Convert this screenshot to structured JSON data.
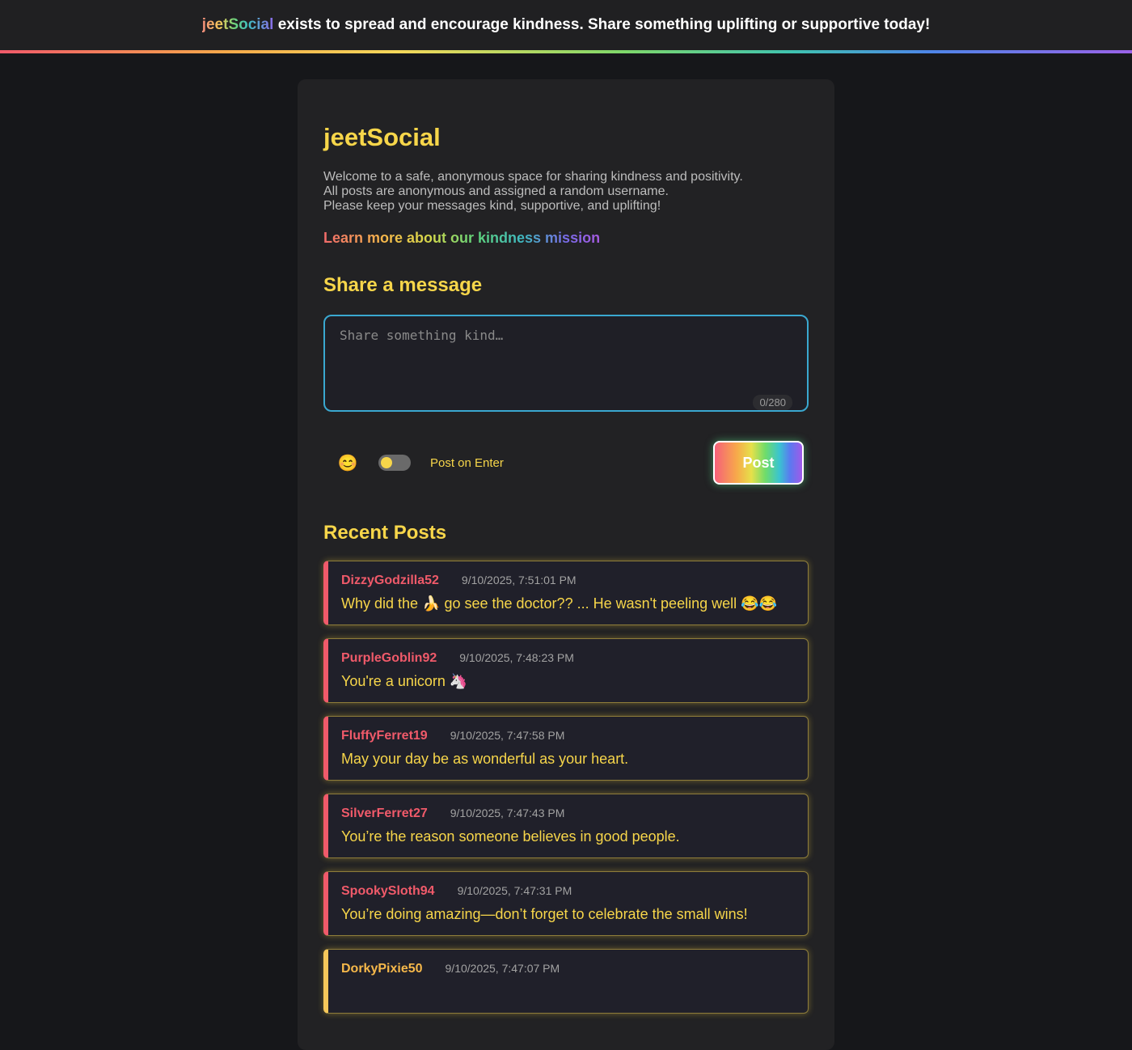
{
  "banner": {
    "brand_part1": "jeet",
    "brand_part2": "Social",
    "message": "exists to spread and encourage kindness. Share something uplifting or supportive today!"
  },
  "header": {
    "title": "jeetSocial",
    "intro_lines": [
      "Welcome to a safe, anonymous space for sharing kindness and positivity.",
      "All posts are anonymous and assigned a random username.",
      "Please keep your messages kind, supportive, and uplifting!"
    ],
    "mission_link": "Learn more about our kindness mission"
  },
  "composer": {
    "section_title": "Share a message",
    "placeholder": "Share something kind…",
    "value": "",
    "counter": "0/280",
    "emoji_button": "😊",
    "toggle_label": "Post on Enter",
    "toggle_on": false,
    "post_button": "Post"
  },
  "feed": {
    "section_title": "Recent Posts",
    "posts": [
      {
        "username": "DizzyGodzilla52",
        "timestamp": "9/10/2025, 7:51:01 PM",
        "message": "Why did the 🍌 go see the doctor??   ... He wasn't peeling well 😂😂"
      },
      {
        "username": "PurpleGoblin92",
        "timestamp": "9/10/2025, 7:48:23 PM",
        "message": "You're a unicorn 🦄"
      },
      {
        "username": "FluffyFerret19",
        "timestamp": "9/10/2025, 7:47:58 PM",
        "message": "May your day be as wonderful as your heart."
      },
      {
        "username": "SilverFerret27",
        "timestamp": "9/10/2025, 7:47:43 PM",
        "message": "You’re the reason someone believes in good people."
      },
      {
        "username": "SpookySloth94",
        "timestamp": "9/10/2025, 7:47:31 PM",
        "message": "You’re doing amazing—don’t forget to celebrate the small wins!"
      },
      {
        "username": "DorkyPixie50",
        "timestamp": "9/10/2025, 7:47:07 PM",
        "message": ""
      }
    ]
  },
  "colors": {
    "accent_yellow": "#f7d64a",
    "username_red": "#f05a6a",
    "composer_border": "#3aa8d0",
    "background": "#16171a",
    "card": "#222224"
  }
}
